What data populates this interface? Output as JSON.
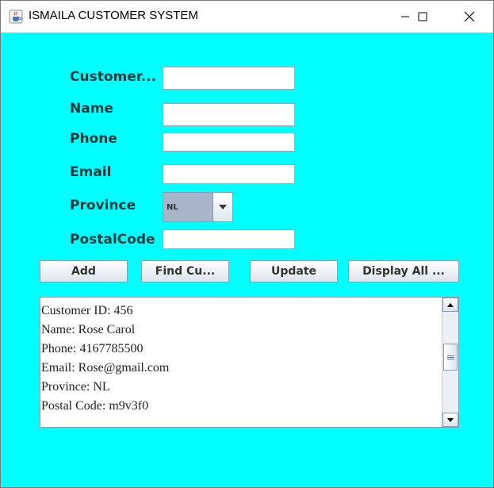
{
  "window": {
    "title": "ISMAILA CUSTOMER SYSTEM",
    "controls": [
      "minimize-icon",
      "maximize-icon",
      "close-icon"
    ]
  },
  "form": {
    "labels": {
      "customer_id": "Customer...",
      "name": "Name",
      "phone": "Phone",
      "email": "Email",
      "province": "Province",
      "postal_code": "PostalCode"
    },
    "values": {
      "customer_id": "",
      "name": "",
      "phone": "",
      "email": "",
      "postal_code": ""
    },
    "province_selected": "NL"
  },
  "buttons": {
    "add": "Add",
    "find": "Find Cu...",
    "update": "Update",
    "display_all": "Display All ..."
  },
  "output": {
    "lines": [
      "Customer ID: 456",
      "Name: Rose Carol",
      "Phone: 4167785500",
      "Email: Rose@gmail.com",
      "Province: NL",
      "Postal Code: m9v3f0"
    ]
  },
  "colors": {
    "background": "#00ffff",
    "label_text": "#16393c",
    "combo_fill": "#a8b5c9"
  }
}
